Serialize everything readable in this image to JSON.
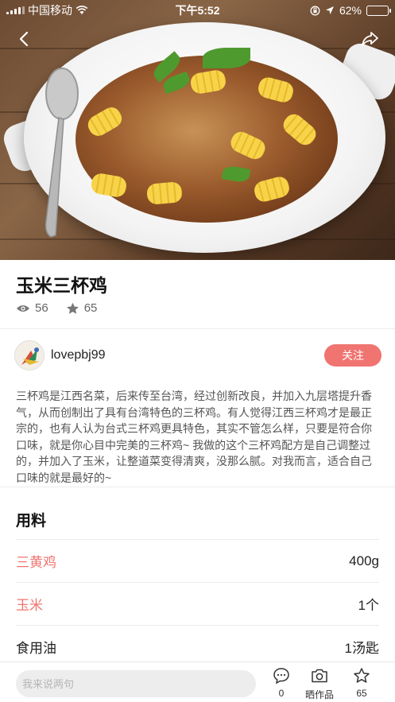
{
  "status_bar": {
    "carrier": "中国移动",
    "time": "下午5:52",
    "battery": "62%",
    "battery_level": 0.62
  },
  "nav": {
    "back_icon": "chevron-left-icon",
    "share_icon": "share-arrow-icon"
  },
  "recipe": {
    "title": "玉米三杯鸡",
    "views": "56",
    "favorites": "65"
  },
  "author": {
    "name": "lovepbj99",
    "follow_label": "关注"
  },
  "description": "三杯鸡是江西名菜，后来传至台湾，经过创新改良，并加入九层塔提升香气，从而创制出了具有台湾特色的三杯鸡。有人觉得江西三杯鸡才是最正宗的，也有人认为台式三杯鸡更具特色，其实不管怎么样，只要是符合你口味，就是你心目中完美的三杯鸡~ 我做的这个三杯鸡配方是自己调整过的，并加入了玉米，让整道菜变得清爽，没那么腻。对我而言，适合自己口味的就是最好的~",
  "ingredients": {
    "title": "用料",
    "items": [
      {
        "name": "三黄鸡",
        "qty": "400g"
      },
      {
        "name": "玉米",
        "qty": "1个"
      },
      {
        "name": "食用油",
        "qty": "1汤匙"
      }
    ]
  },
  "bottom_bar": {
    "comment_placeholder": "我来说两句",
    "comment_count": "0",
    "share_work_label": "晒作品",
    "star_count": "65"
  },
  "colors": {
    "accent": "#f07470",
    "text": "#222222",
    "muted": "#666666"
  }
}
